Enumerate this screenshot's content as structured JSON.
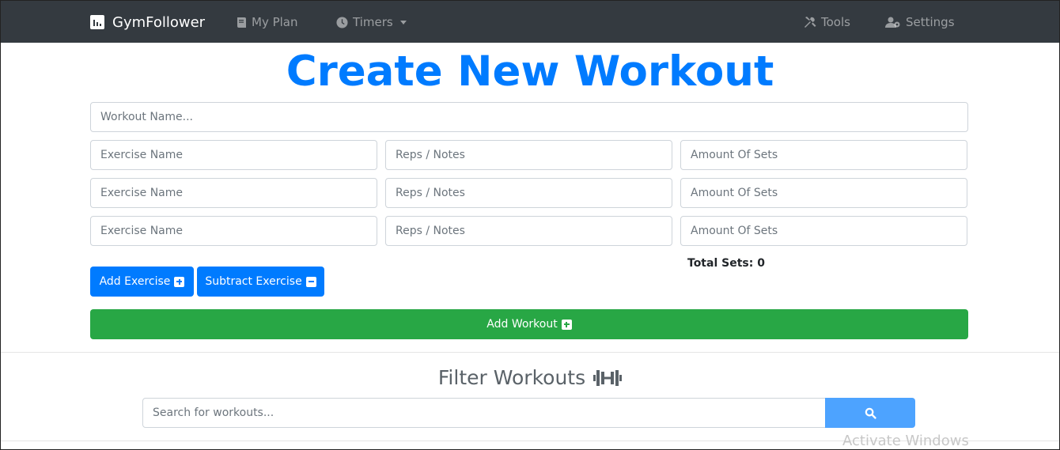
{
  "navbar": {
    "brand": "GymFollower",
    "my_plan": "My Plan",
    "timers": "Timers",
    "tools": "Tools",
    "settings": "Settings"
  },
  "page_title": "Create New Workout",
  "workout_name_placeholder": "Workout Name...",
  "exercise_rows": [
    {
      "name_placeholder": "Exercise Name",
      "reps_placeholder": "Reps / Notes",
      "sets_placeholder": "Amount Of Sets"
    },
    {
      "name_placeholder": "Exercise Name",
      "reps_placeholder": "Reps / Notes",
      "sets_placeholder": "Amount Of Sets"
    },
    {
      "name_placeholder": "Exercise Name",
      "reps_placeholder": "Reps / Notes",
      "sets_placeholder": "Amount Of Sets"
    }
  ],
  "total_sets": "Total Sets: 0",
  "buttons": {
    "add_exercise": "Add Exercise",
    "subtract_exercise": "Subtract Exercise",
    "add_workout": "Add Workout"
  },
  "filter": {
    "title": "Filter Workouts",
    "search_placeholder": "Search for workouts..."
  },
  "watermark": "Activate Windows",
  "colors": {
    "navbar": "#343a40",
    "primary": "#007bff",
    "success": "#28a745",
    "search_button": "#4da3ff"
  },
  "icons": [
    "chart-bar-icon",
    "book-icon",
    "clock-icon",
    "tools-icon",
    "users-cog-icon",
    "plus-square-icon",
    "minus-square-icon",
    "dumbbell-icon",
    "search-icon"
  ]
}
